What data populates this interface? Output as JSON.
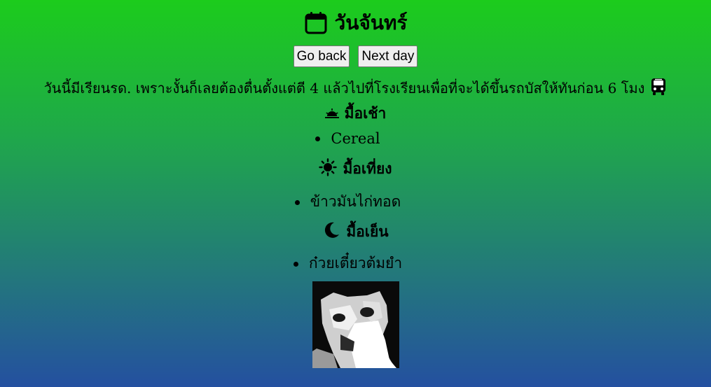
{
  "header": {
    "icon": "calendar-icon",
    "title": "วันจันทร์"
  },
  "nav": {
    "back_label": "Go back",
    "next_label": "Next day"
  },
  "intro": {
    "text": "วันนี้มีเรียนรด. เพราะงั้นก็เลยต้องตื่นตั้งแต่ตี 4 แล้วไปที่โรงเรียนเพื่อที่จะได้ขึ้นรถบัสให้ทันก่อน 6 โมง",
    "icon": "bus-icon"
  },
  "meals": {
    "breakfast": {
      "icon": "sunrise-icon",
      "title": "มื้อเช้า",
      "items": [
        "Cereal"
      ]
    },
    "lunch": {
      "icon": "sun-icon",
      "title": "มื้อเที่ยง",
      "items": [
        "ข้าวมันไก่ทอด"
      ]
    },
    "dinner": {
      "icon": "moon-icon",
      "title": "มื้อเย็น",
      "items": [
        "ก๋วยเตี๋ยวต้มยำ"
      ]
    }
  },
  "image": {
    "subject": "cat-photo"
  }
}
